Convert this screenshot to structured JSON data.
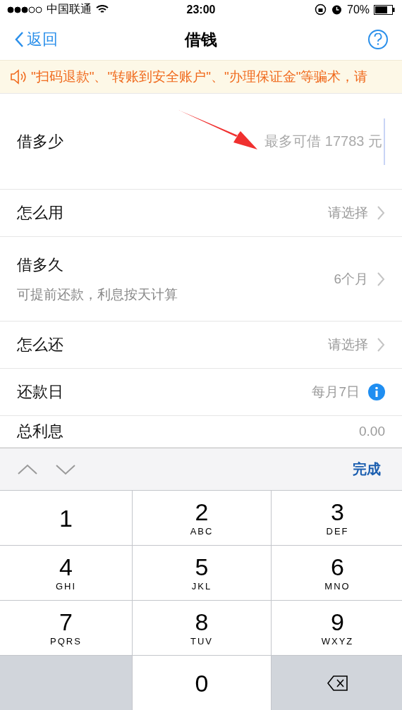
{
  "status_bar": {
    "carrier": "中国联通",
    "time": "23:00",
    "battery": "70%"
  },
  "nav": {
    "back": "返回",
    "title": "借钱"
  },
  "notice": {
    "text": "\"扫码退款\"、\"转账到安全账户\"、\"办理保证金\"等骗术，请"
  },
  "amount": {
    "label": "借多少",
    "placeholder": "最多可借 17783 元"
  },
  "rows": [
    {
      "kind": "select",
      "label": "怎么用",
      "value": "请选择"
    },
    {
      "kind": "select",
      "label": "借多久",
      "sub": "可提前还款，利息按天计算",
      "value": "6个月"
    },
    {
      "kind": "select",
      "label": "怎么还",
      "value": "请选择"
    },
    {
      "kind": "info",
      "label": "还款日",
      "value": "每月7日"
    },
    {
      "kind": "plain",
      "label": "总利息",
      "value": "0.00"
    }
  ],
  "keyboard": {
    "done": "完成",
    "keys": [
      {
        "kind": "digit",
        "digit": "1"
      },
      {
        "kind": "digit",
        "digit": "2",
        "letters": "ABC"
      },
      {
        "kind": "digit",
        "digit": "3",
        "letters": "DEF"
      },
      {
        "kind": "digit",
        "digit": "4",
        "letters": "GHI"
      },
      {
        "kind": "digit",
        "digit": "5",
        "letters": "JKL"
      },
      {
        "kind": "digit",
        "digit": "6",
        "letters": "MNO"
      },
      {
        "kind": "digit",
        "digit": "7",
        "letters": "PQRS"
      },
      {
        "kind": "digit",
        "digit": "8",
        "letters": "TUV"
      },
      {
        "kind": "digit",
        "digit": "9",
        "letters": "WXYZ"
      },
      {
        "kind": "blank"
      },
      {
        "kind": "digit",
        "digit": "0"
      },
      {
        "kind": "delete"
      }
    ]
  }
}
